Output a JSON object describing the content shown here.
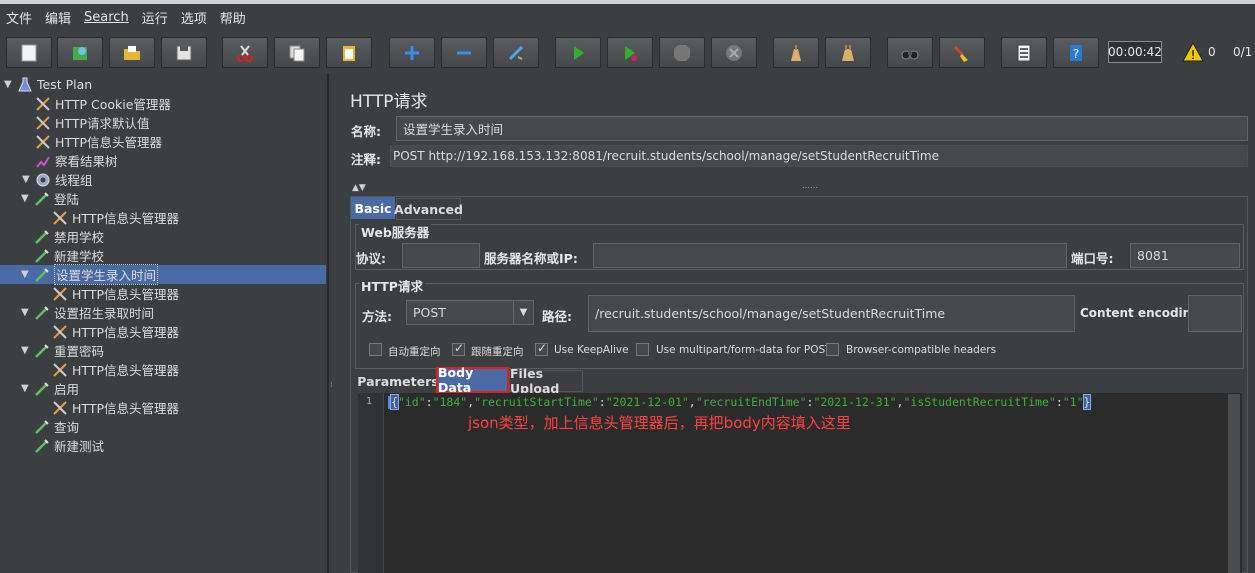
{
  "menu": [
    "文件",
    "编辑",
    "Search",
    "运行",
    "选项",
    "帮助"
  ],
  "toolbar": {
    "icons": [
      "new-icon",
      "templates-icon",
      "open-icon",
      "save-icon",
      "cut-icon",
      "copy-icon",
      "paste-icon",
      "expand-icon",
      "collapse-icon",
      "toggle-icon",
      "start-icon",
      "start-no-pause-icon",
      "stop-icon",
      "shutdown-icon",
      "clear-icon",
      "clear-all-icon",
      "search-icon",
      "reset-search-icon",
      "function-helper-icon",
      "help-icon"
    ],
    "timer": "00:00:42",
    "warning_count": "0",
    "threads_ratio": "0/1"
  },
  "tree": [
    {
      "label": "Test Plan",
      "icon": "flask-icon",
      "toggle": "▼",
      "level": 0
    },
    {
      "label": "HTTP Cookie管理器",
      "icon": "wrench-icon",
      "toggle": "",
      "level": 1
    },
    {
      "label": "HTTP请求默认值",
      "icon": "wrench-icon",
      "toggle": "",
      "level": 1
    },
    {
      "label": "HTTP信息头管理器",
      "icon": "wrench-icon",
      "toggle": "",
      "level": 1
    },
    {
      "label": "察看结果树",
      "icon": "chart-icon",
      "toggle": "",
      "level": 1
    },
    {
      "label": "线程组",
      "icon": "gear-icon",
      "toggle": "▼",
      "level": 1
    },
    {
      "label": "登陆",
      "icon": "pipette-icon",
      "toggle": "▼",
      "level": 2
    },
    {
      "label": "HTTP信息头管理器",
      "icon": "wrench-icon",
      "toggle": "",
      "level": 3
    },
    {
      "label": "禁用学校",
      "icon": "pipette-icon",
      "toggle": "",
      "level": 2
    },
    {
      "label": "新建学校",
      "icon": "pipette-icon",
      "toggle": "",
      "level": 2
    },
    {
      "label": "设置学生录入时间",
      "icon": "pipette-icon",
      "toggle": "▼",
      "level": 2,
      "selected": true
    },
    {
      "label": "HTTP信息头管理器",
      "icon": "wrench-icon",
      "toggle": "",
      "level": 3
    },
    {
      "label": "设置招生录取时间",
      "icon": "pipette-icon",
      "toggle": "▼",
      "level": 2
    },
    {
      "label": "HTTP信息头管理器",
      "icon": "wrench-icon",
      "toggle": "",
      "level": 3
    },
    {
      "label": "重置密码",
      "icon": "pipette-icon",
      "toggle": "▼",
      "level": 2
    },
    {
      "label": "HTTP信息头管理器",
      "icon": "wrench-icon",
      "toggle": "",
      "level": 3
    },
    {
      "label": "启用",
      "icon": "pipette-icon",
      "toggle": "▼",
      "level": 2
    },
    {
      "label": "HTTP信息头管理器",
      "icon": "wrench-icon",
      "toggle": "",
      "level": 3
    },
    {
      "label": "查询",
      "icon": "pipette-icon",
      "toggle": "",
      "level": 2
    },
    {
      "label": "新建测试",
      "icon": "pipette-icon",
      "toggle": "",
      "level": 2
    }
  ],
  "panel": {
    "title": "HTTP请求",
    "name_label": "名称:",
    "name_value": "设置学生录入时间",
    "comment_label": "注释:",
    "comment_value": "POST http://192.168.153.132:8081/recruit.students/school/manage/setStudentRecruitTime",
    "tabs": [
      "Basic",
      "Advanced"
    ],
    "web_server": {
      "legend": "Web服务器",
      "protocol_label": "协议:",
      "protocol_value": "",
      "server_label": "服务器名称或IP:",
      "server_value": "",
      "port_label": "端口号:",
      "port_value": "8081"
    },
    "http_request": {
      "legend": "HTTP请求",
      "method_label": "方法:",
      "method_value": "POST",
      "path_label": "路径:",
      "path_value": "/recruit.students/school/manage/setStudentRecruitTime",
      "encoding_label": "Content encoding:",
      "encoding_value": ""
    },
    "checkboxes": [
      {
        "label": "自动重定向",
        "checked": false
      },
      {
        "label": "跟随重定向",
        "checked": true
      },
      {
        "label": "Use KeepAlive",
        "checked": true
      },
      {
        "label": "Use multipart/form-data for POST",
        "checked": false
      },
      {
        "label": "Browser-compatible headers",
        "checked": false
      }
    ],
    "sub_tabs": [
      "Parameters",
      "Body Data",
      "Files Upload"
    ],
    "editor": {
      "line_number": "1",
      "code_parts": [
        {
          "t": "{",
          "c": "#dcdcdc"
        },
        {
          "t": "\"id\"",
          "c": "#3fae3f"
        },
        {
          "t": ":",
          "c": "#dcdcdc"
        },
        {
          "t": "\"184\"",
          "c": "#3fae3f"
        },
        {
          "t": ",",
          "c": "#dcdcdc"
        },
        {
          "t": "\"recruitStartTime\"",
          "c": "#3fae3f"
        },
        {
          "t": ":",
          "c": "#dcdcdc"
        },
        {
          "t": "\"2021-12-01\"",
          "c": "#3fae3f"
        },
        {
          "t": ",",
          "c": "#dcdcdc"
        },
        {
          "t": "\"recruitEndTime\"",
          "c": "#3fae3f"
        },
        {
          "t": ":",
          "c": "#dcdcdc"
        },
        {
          "t": "\"2021-12-31\"",
          "c": "#3fae3f"
        },
        {
          "t": ",",
          "c": "#dcdcdc"
        },
        {
          "t": "\"isStudentRecruitTime\"",
          "c": "#3fae3f"
        },
        {
          "t": ":",
          "c": "#dcdcdc"
        },
        {
          "t": "\"1\"",
          "c": "#3fae3f"
        },
        {
          "t": "}",
          "c": "#dcdcdc"
        }
      ]
    },
    "annotation": "json类型，加上信息头管理器后，再把body内容填入这里"
  },
  "colors": {
    "accent": "#4a6aa5",
    "annotation": "#ff4040",
    "string": "#3fae3f"
  }
}
